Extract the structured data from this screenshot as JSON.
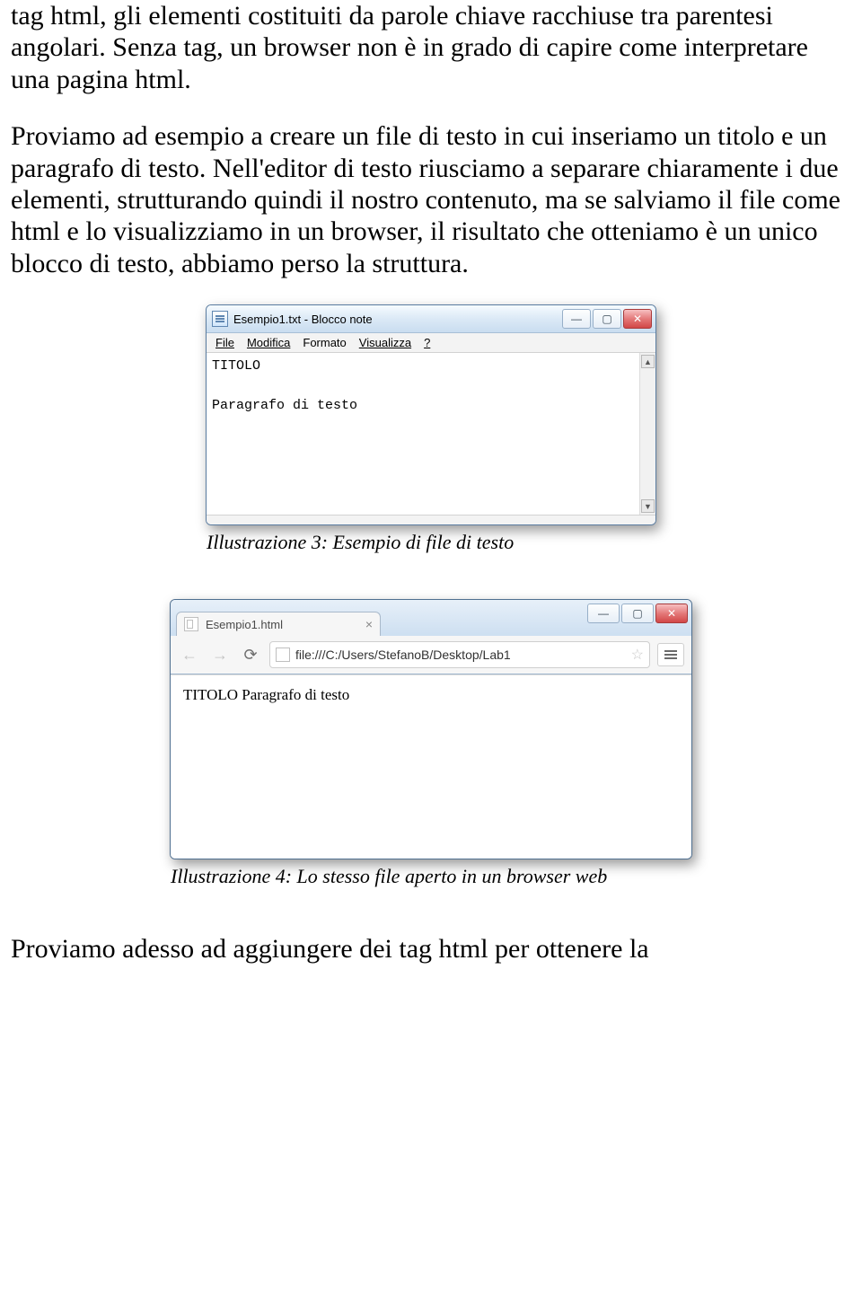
{
  "paragraphs": {
    "p1": "tag html, gli elementi costituiti da parole chiave racchiuse tra parentesi angolari. Senza tag, un browser non è in grado di capire come interpretare una pagina html.",
    "p2": "Proviamo ad esempio a creare un file di testo in cui inseriamo un titolo e un paragrafo di testo. Nell'editor di testo riusciamo a separare chiaramente i due elementi, strutturando quindi il nostro contenuto, ma se salviamo il file come html e lo visualizziamo in un browser, il risultato che otteniamo è un unico blocco di testo, abbiamo perso la struttura.",
    "p3": "Proviamo adesso ad aggiungere dei tag html per ottenere la"
  },
  "notepad": {
    "title": "Esempio1.txt - Blocco note",
    "menus": {
      "file": "File",
      "modifica": "Modifica",
      "formato": "Formato",
      "visualizza": "Visualizza",
      "help": "?"
    },
    "content_line1": "TITOLO",
    "content_line2": "Paragrafo di testo",
    "caption": "Illustrazione 3: Esempio di file di testo"
  },
  "browser": {
    "tab_title": "Esempio1.html",
    "url": "file:///C:/Users/StefanoB/Desktop/Lab1",
    "page_text": "TITOLO Paragrafo di testo",
    "caption": "Illustrazione 4: Lo stesso file aperto in un browser web"
  },
  "icons": {
    "min": "—",
    "max": "▢",
    "close": "✕",
    "back": "←",
    "forward": "→",
    "reload": "⟳",
    "star": "☆",
    "tab_close": "×",
    "scroll_up": "▲",
    "scroll_down": "▼"
  }
}
